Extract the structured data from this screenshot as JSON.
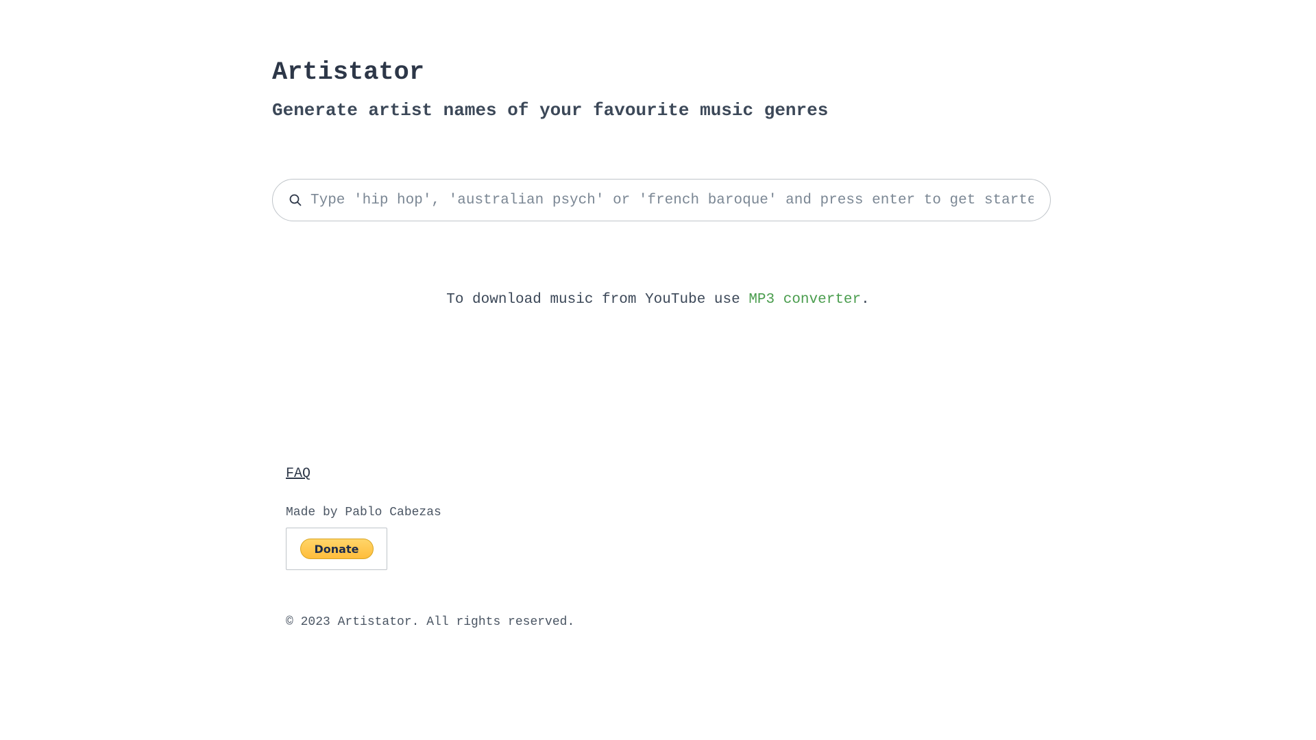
{
  "header": {
    "title": "Artistator",
    "subtitle": "Generate artist names of your favourite music genres"
  },
  "search": {
    "icon": "search-icon",
    "placeholder": "Type 'hip hop', 'australian psych' or 'french baroque' and press enter to get started",
    "value": ""
  },
  "promo": {
    "text_before": "To download music from YouTube use ",
    "link_label": "MP3 converter",
    "text_after": ".",
    "link_color": "#4a9d4e"
  },
  "footer": {
    "faq_label": "FAQ",
    "made_by": "Made by Pablo Cabezas",
    "donate_label": "Donate",
    "donate_color": "#ffc439",
    "copyright": "© 2023 Artistator. All rights reserved."
  }
}
